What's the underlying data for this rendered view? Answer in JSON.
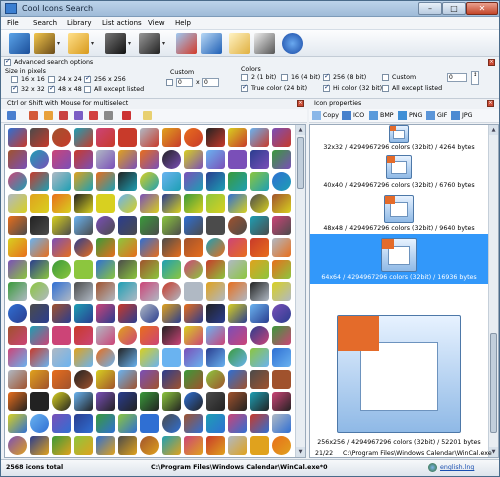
{
  "window": {
    "title": "Cool Icons Search",
    "min_glyph": "–",
    "max_glyph": "□",
    "close_glyph": "✕"
  },
  "menu": [
    "File",
    "Search",
    "Library",
    "List actions",
    "View",
    "Help"
  ],
  "toolbar": {
    "buttons": [
      "search-icon",
      "library-icon",
      "open-folder-icon",
      "save-icon",
      "save-as-icon",
      "extract-icon",
      "copy-icon",
      "export-icon",
      "export-all-icon",
      "help-icon"
    ],
    "arrow_glyph": "▾"
  },
  "options": {
    "advanced_label": "Advanced search options",
    "advanced_checked": true,
    "size_heading": "Size in pixels",
    "sizes": [
      {
        "label": "16 x 16",
        "checked": false
      },
      {
        "label": "24 x 24",
        "checked": false
      },
      {
        "label": "256 x 256",
        "checked": true
      },
      {
        "label": "32 x 32",
        "checked": true
      },
      {
        "label": "48 x 48",
        "checked": true
      },
      {
        "label": "All except listed",
        "checked": false
      }
    ],
    "custom_heading": "Custom",
    "custom_w": "0",
    "custom_x": "x",
    "custom_h": "0",
    "colors_heading": "Colors",
    "colors": [
      {
        "label": "2 (1 bit)",
        "checked": false
      },
      {
        "label": "16 (4 bit)",
        "checked": false
      },
      {
        "label": "256 (8 bit)",
        "checked": true
      },
      {
        "label": "True color (24 bit)",
        "checked": true
      },
      {
        "label": "Hi color (32 bit)",
        "checked": true
      },
      {
        "label": "All except listed",
        "checked": false
      },
      {
        "label": "Custom",
        "checked": false
      }
    ],
    "colors_custom_value": "0"
  },
  "left_caption": "Ctrl or Shift with Mouse for multiselect",
  "right_caption": "Icon properties",
  "export_buttons": [
    "Copy",
    "ICO",
    "BMP",
    "PNG",
    "GIF",
    "JPG"
  ],
  "previews": [
    {
      "caption": "32x32 / 4294967296 colors (32bit) / 4264 bytes",
      "selected": false
    },
    {
      "caption": "40x40 / 4294967296 colors (32bit) / 6760 bytes",
      "selected": false
    },
    {
      "caption": "48x48 / 4294967296 colors (32bit) / 9640 bytes",
      "selected": false
    },
    {
      "caption": "64x64 / 4294967296 colors (32bit) / 16936 bytes",
      "selected": true
    },
    {
      "caption": "256x256 / 4294967296 colors (32bit) / 52201 bytes",
      "selected": false
    }
  ],
  "preview_status": {
    "index": "21/22",
    "path": "C:\\Program Files\\Windows Calendar\\WinCal.exe"
  },
  "status": {
    "total": "2568 icons total",
    "path": "C:\\Program Files\\Windows Calendar\\WinCal.exe*0",
    "lang": "english.lng"
  },
  "grid_colors": [
    "#2f6fd3",
    "#e0a21d",
    "#3a9a3a",
    "#c83a2a",
    "#7a4fb8",
    "#1d9fb4",
    "#d8d020",
    "#4b4b4b",
    "#e86e1c",
    "#8cc63e",
    "#b0b9c4",
    "#2a3d8f",
    "#cc4477",
    "#6ab3f0",
    "#a0522d",
    "#222222"
  ]
}
